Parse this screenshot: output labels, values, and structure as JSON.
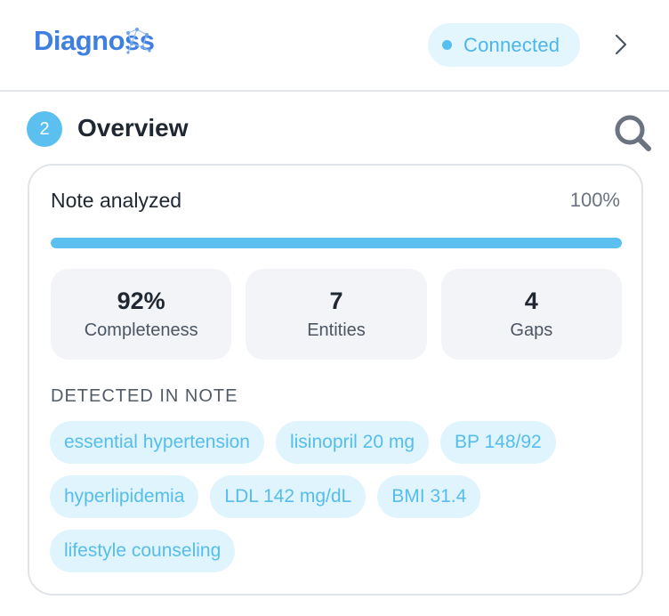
{
  "header": {
    "logo_text": "Diagnoss",
    "status": {
      "label": "Connected",
      "color": "#56bff0"
    },
    "chevron_icon": "chevron-right-icon"
  },
  "section": {
    "step_number": "2",
    "title": "Overview",
    "search_icon": "search-icon"
  },
  "progress": {
    "label": "Note analyzed",
    "percent_text": "100%",
    "value": 1.0
  },
  "stats": [
    {
      "value": "92%",
      "label": "Completeness"
    },
    {
      "value": "7",
      "label": "Entities"
    },
    {
      "value": "4",
      "label": "Gaps"
    }
  ],
  "detected": {
    "heading": "DETECTED IN NOTE",
    "tags": [
      "essential hypertension",
      "lisinopril 20 mg",
      "BP 148/92",
      "hyperlipidemia",
      "LDL 142 mg/dL",
      "BMI 31.4",
      "lifestyle counseling"
    ]
  },
  "colors": {
    "accent": "#5bc0ef",
    "tag_bg": "#dff4fc",
    "tag_text": "#56bdec",
    "logo": "#3f7fe0"
  }
}
